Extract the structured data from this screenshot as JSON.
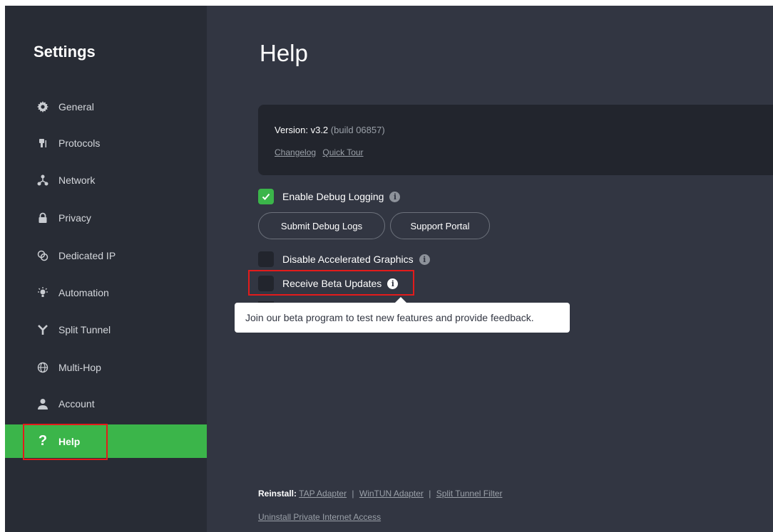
{
  "sidebar": {
    "title": "Settings",
    "items": [
      {
        "label": "General",
        "icon": "gear-icon"
      },
      {
        "label": "Protocols",
        "icon": "plug-icon"
      },
      {
        "label": "Network",
        "icon": "network-icon"
      },
      {
        "label": "Privacy",
        "icon": "lock-icon"
      },
      {
        "label": "Dedicated IP",
        "icon": "dedicated-ip-icon"
      },
      {
        "label": "Automation",
        "icon": "lightbulb-icon"
      },
      {
        "label": "Split Tunnel",
        "icon": "split-tunnel-icon"
      },
      {
        "label": "Multi-Hop",
        "icon": "globe-icon"
      },
      {
        "label": "Account",
        "icon": "person-icon"
      },
      {
        "label": "Help",
        "icon": "question-icon",
        "active": true
      }
    ]
  },
  "main": {
    "title": "Help",
    "version": {
      "prefix": "Version: v3.2",
      "build": "(build 06857)",
      "changelog": "Changelog",
      "quick_tour": "Quick Tour"
    },
    "options": {
      "debug_logging": {
        "label": "Enable Debug Logging",
        "checked": true
      },
      "accelerated_graphics": {
        "label": "Disable Accelerated Graphics",
        "checked": false
      },
      "beta_updates": {
        "label": "Receive Beta Updates",
        "checked": false
      }
    },
    "buttons": {
      "submit_logs": "Submit Debug Logs",
      "support_portal": "Support Portal"
    },
    "tooltip": "Join our beta program to test new features and provide feedback.",
    "reinstall": {
      "label": "Reinstall:",
      "tap": "TAP Adapter",
      "wintun": "WinTUN Adapter",
      "split_filter": "Split Tunnel Filter",
      "separator": "|"
    },
    "uninstall": "Uninstall Private Internet Access"
  },
  "colors": {
    "accent": "#3bb54a",
    "sidebar_bg": "#282c35",
    "main_bg": "#323642",
    "highlight": "#e31b1b"
  }
}
